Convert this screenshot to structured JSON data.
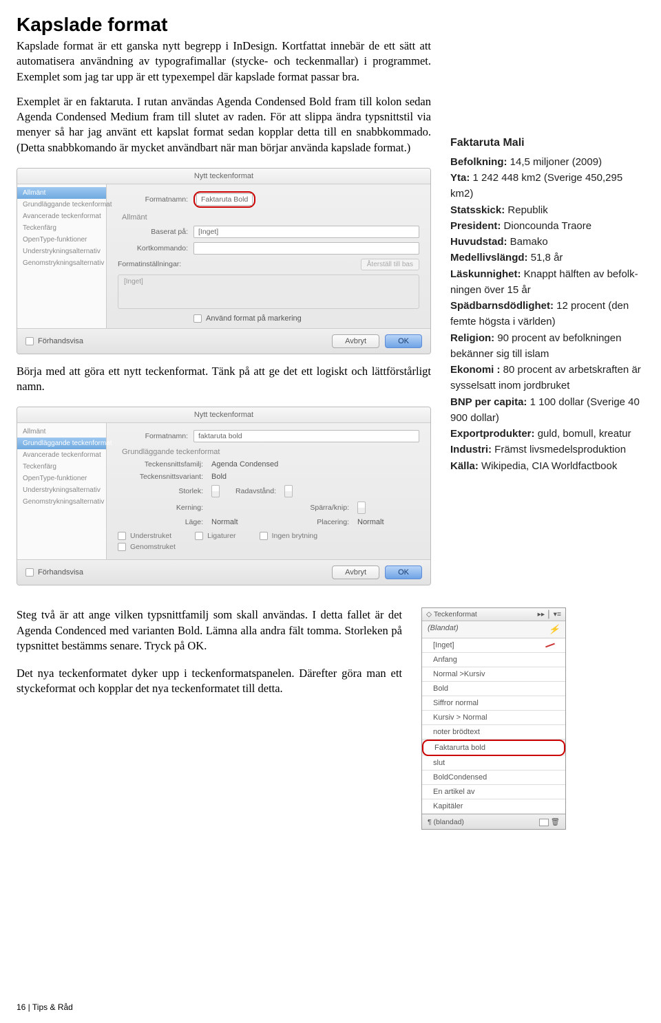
{
  "doc": {
    "heading": "Kapslade format",
    "intro": "Kapslade format är ett ganska nytt begrepp i InDesign. Kort­fattat innebär de ett sätt att automatisera användning av typografimallar (stycke- och teckenmallar) i programmet. Exemplet som jag tar upp är ett typexempel där kapslade format passar bra.",
    "para2": "Exemplet är en faktaruta. I rutan användas Agenda Conden­sed Bold fram till kolon sedan Agenda Condensed Medium fram till slutet av raden. För att slippa ändra typsnittstil via menyer så har jag använt ett kapslat format sedan kopp­lar detta till en snabbkommado. (Detta snabbkomando är mycket användbart när man börjar använda kapslade for­mat.)",
    "para3": "Börja med att göra ett nytt teckenformat. Tänk på att ge det ett logiskt och lättförstårligt namn.",
    "para4": "Steg två är att ange vilken typsnittfamilj som skall användas. I detta fallet är det Agenda Condenced med varianten Bold. Lämna alla andra fält tomma. Storleken på typsnittet be­stämms senare. Tryck på OK.",
    "para5": "Det nya teckenformatet dyker upp i teckenformatspanelen. Därefter göra man ett styckeformat och kopplar det nya teck­enformatet till detta.",
    "footer": "16 | Tips & Råd"
  },
  "faktaruta": {
    "title": "Faktaruta Mali",
    "rows": [
      {
        "k": "Befolkning:",
        "v": "14,5 miljoner (2009)"
      },
      {
        "k": "Yta:",
        "v": "1 242 448 km2 (Sverige 450,295 km2)"
      },
      {
        "k": "Statsskick:",
        "v": "Republik"
      },
      {
        "k": "President:",
        "v": "Dioncounda Traore"
      },
      {
        "k": "Huvudstad:",
        "v": "Bamako"
      },
      {
        "k": "Medellivslängd:",
        "v": "51,8 år"
      },
      {
        "k": "Läskunnighet:",
        "v": "Knappt hälften av befolk­ningen över 15 år"
      },
      {
        "k": "Spädbarnsdödlighet:",
        "v": "12 procent (den femte högsta i världen)"
      },
      {
        "k": "Religion:",
        "v": "90 procent av befolkningen bekänner sig till islam"
      },
      {
        "k": "Ekonomi :",
        "v": "80 procent av arbetskraften är sysselsatt inom jordbruket"
      },
      {
        "k": "BNP per capita:",
        "v": "1 100 dollar (Sverige 40 900 dollar)"
      },
      {
        "k": "Exportprodukter:",
        "v": "guld, bomull, kreatur"
      },
      {
        "k": "Industri:",
        "v": "Främst livsmedelsproduktion"
      },
      {
        "k": "Källa:",
        "v": "Wikipedia, CIA Worldfactbook"
      }
    ]
  },
  "dialog1": {
    "title": "Nytt teckenformat",
    "sidebar": [
      "Allmänt",
      "Grundläggande teckenformat",
      "Avancerade teckenformat",
      "Teckenfärg",
      "OpenType-funktioner",
      "Understrykningsalternativ",
      "Genomstrykningsalternativ"
    ],
    "formatnamn_label": "Formatnamn:",
    "formatnamn_value": "Faktaruta Bold",
    "section": "Allmänt",
    "baserat_label": "Baserat på:",
    "baserat_value": "[Inget]",
    "kort_label": "Kortkommando:",
    "kort_value": "",
    "format_inst_label": "Formatinställningar:",
    "reset_btn": "Återställ till bas",
    "well_text": "[Inget]",
    "apply_chk": "Använd format på markering",
    "preview_label": "Förhandsvisa",
    "cancel": "Avbryt",
    "ok": "OK"
  },
  "dialog2": {
    "title": "Nytt teckenformat",
    "sidebar": [
      "Allmänt",
      "Grundläggande teckenformat",
      "Avancerade teckenformat",
      "Teckenfärg",
      "OpenType-funktioner",
      "Understrykningsalternativ",
      "Genomstrykningsalternativ"
    ],
    "formatnamn_label": "Formatnamn:",
    "formatnamn_value": "faktaruta bold",
    "section": "Grundläggande teckenformat",
    "family_label": "Teckensnittsfamilj:",
    "family_value": "Agenda Condensed",
    "variant_label": "Teckensnittsvariant:",
    "variant_value": "Bold",
    "size_label": "Storlek:",
    "kerning_label": "Kerning:",
    "lage_label": "Läge:",
    "lage_value": "Normalt",
    "rad_label": "Radavstånd:",
    "sparra_label": "Spärra/knip:",
    "placering_label": "Placering:",
    "placering_value": "Normalt",
    "chk_under": "Understruket",
    "chk_lig": "Ligaturer",
    "chk_nobr": "Ingen brytning",
    "chk_strike": "Genomstruket",
    "preview_label": "Förhandsvisa",
    "cancel": "Avbryt",
    "ok": "OK"
  },
  "panel": {
    "tab": "Teckenformat",
    "top": "(Blandat)",
    "items": [
      "[Inget]",
      "Anfang",
      "Normal >Kursiv",
      "Bold",
      "Siffror normal",
      "Kursiv > Normal",
      "noter brödtext",
      "Faktarurta bold",
      "slut",
      "BoldCondensed",
      "En artikel av",
      "Kapitäler"
    ],
    "highlight_index": 7,
    "footer_text": "¶ (blandad)"
  }
}
